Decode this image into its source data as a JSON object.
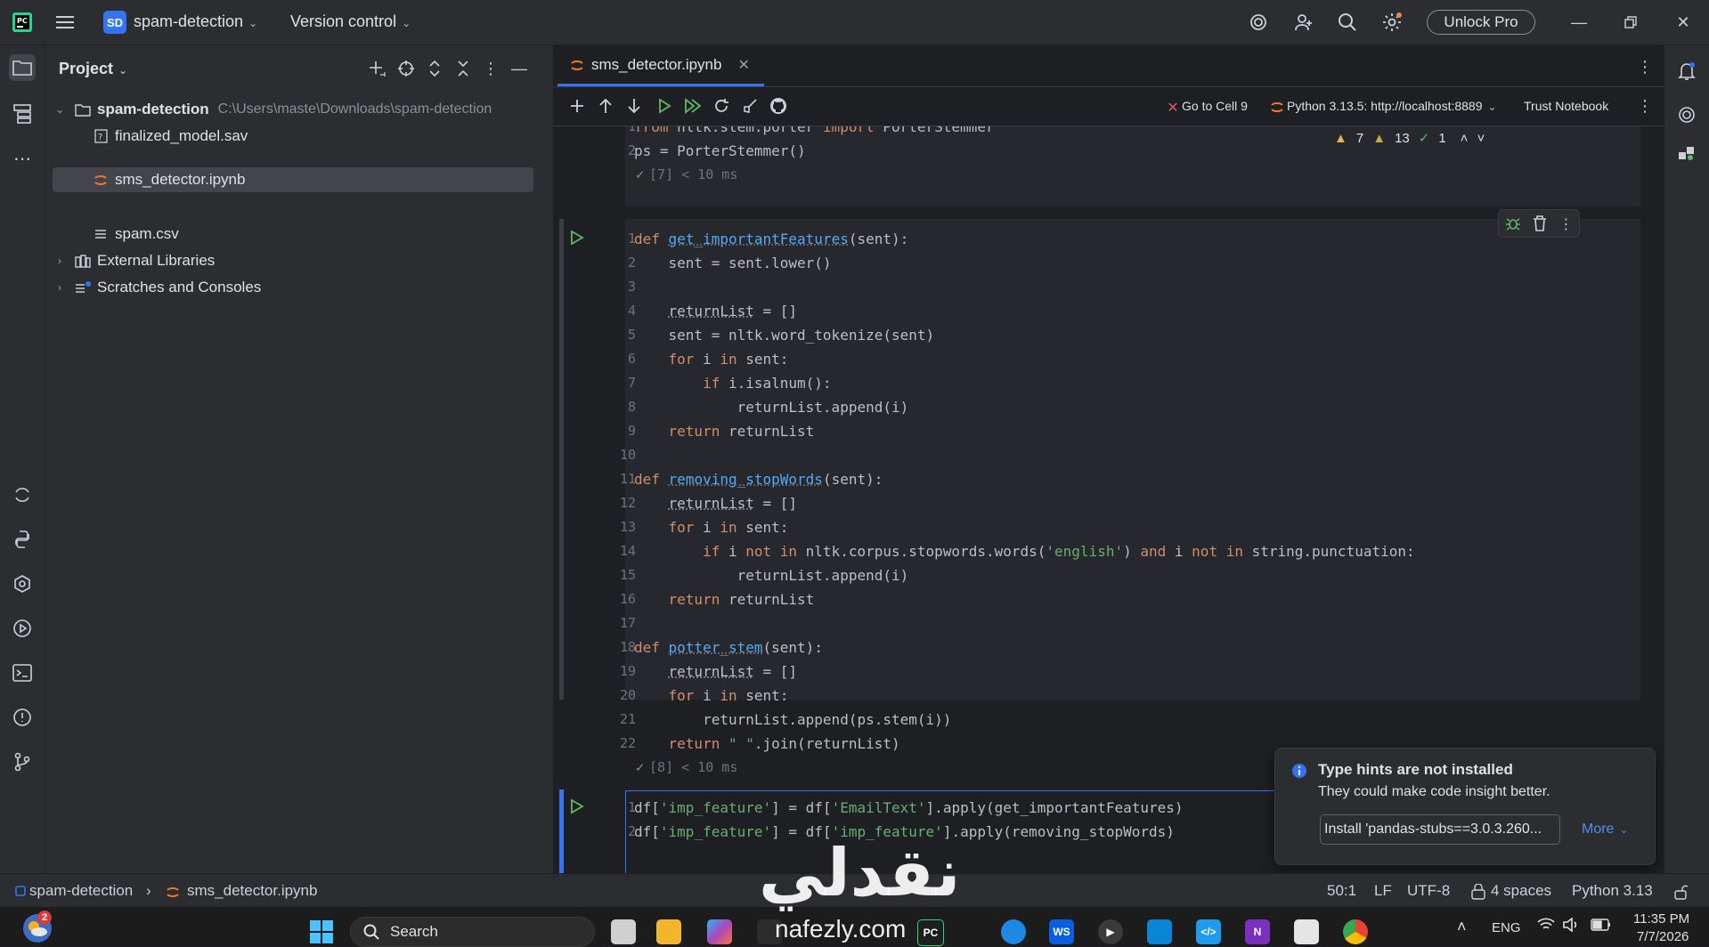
{
  "titlebar": {
    "project_badge": "SD",
    "project_name": "spam-detection",
    "version_control": "Version control",
    "unlock_pro": "Unlock Pro"
  },
  "project_panel": {
    "title": "Project",
    "tree": [
      {
        "label": "spam-detection",
        "path": "C:\\Users\\maste\\Downloads\\spam-detection"
      },
      {
        "label": "finalized_model.sav"
      },
      {
        "label": "sms_detector.ipynb"
      },
      {
        "label": "spam.csv"
      },
      {
        "label": "External Libraries"
      },
      {
        "label": "Scratches and Consoles"
      }
    ]
  },
  "editor": {
    "tab_label": "sms_detector.ipynb",
    "toolbar": {
      "go_to_cell": "Go to Cell 9",
      "kernel": "Python 3.13.5: http://localhost:8889",
      "trust": "Trust Notebook"
    },
    "inspections": {
      "warnings": "7",
      "weak_warnings": "13",
      "ok": "1"
    },
    "cell1": {
      "lines": [
        {
          "n": "1",
          "code": "from nltk.stem.porter import PorterStemmer"
        },
        {
          "n": "2",
          "code": "ps = PorterStemmer()"
        }
      ],
      "exec": "[7] < 10 ms"
    },
    "cell2": {
      "exec": "[8] < 10 ms"
    },
    "cell3": {}
  },
  "notification": {
    "title": "Type hints are not installed",
    "body": "They could make code insight better.",
    "install_button": "Install 'pandas-stubs==3.0.3.260...",
    "more": "More"
  },
  "statusbar": {
    "crumb_project": "spam-detection",
    "crumb_file": "sms_detector.ipynb",
    "position": "50:1",
    "line_sep": "LF",
    "encoding": "UTF-8",
    "indent": "4 spaces",
    "interpreter": "Python 3.13"
  },
  "taskbar": {
    "search": "Search",
    "badge": "2",
    "lang": "ENG",
    "time": "11:35 PM",
    "date": "7/7/2026"
  },
  "watermark": {
    "arabic": "نقدلي",
    "url": "nafezly.com"
  },
  "colors": {
    "accent": "#3574f0",
    "keyword": "#cf8e6d",
    "function": "#56a8f5",
    "string": "#6aab73"
  }
}
